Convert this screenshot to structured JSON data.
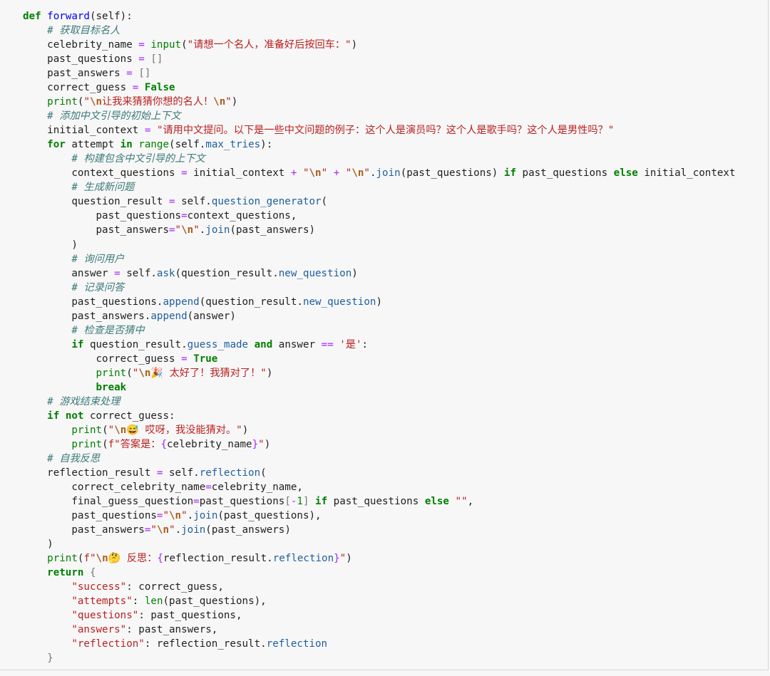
{
  "lines": [
    [
      [
        "k",
        "def"
      ],
      [
        "n",
        " "
      ],
      [
        "f",
        "forward"
      ],
      [
        "p",
        "(self):"
      ]
    ],
    [
      [
        "n",
        "    "
      ],
      [
        "c",
        "# 获取目标名人"
      ]
    ],
    [
      [
        "n",
        "    celebrity_name "
      ],
      [
        "o",
        "="
      ],
      [
        "n",
        " "
      ],
      [
        "b",
        "input"
      ],
      [
        "p",
        "("
      ],
      [
        "s",
        "\"请想一个名人，准备好后按回车：\""
      ],
      [
        "p",
        ")"
      ]
    ],
    [
      [
        "n",
        "    past_questions "
      ],
      [
        "o",
        "="
      ],
      [
        "n",
        " "
      ],
      [
        "pb",
        "[]"
      ]
    ],
    [
      [
        "n",
        "    past_answers "
      ],
      [
        "o",
        "="
      ],
      [
        "n",
        " "
      ],
      [
        "pb",
        "[]"
      ]
    ],
    [
      [
        "n",
        "    correct_guess "
      ],
      [
        "o",
        "="
      ],
      [
        "n",
        " "
      ],
      [
        "k",
        "False"
      ]
    ],
    [
      [
        "n",
        "    "
      ],
      [
        "b",
        "print"
      ],
      [
        "p",
        "("
      ],
      [
        "s",
        "\""
      ],
      [
        "e",
        "\\n"
      ],
      [
        "s",
        "让我来猜猜你想的名人！"
      ],
      [
        "e",
        "\\n"
      ],
      [
        "s",
        "\""
      ],
      [
        "p",
        ")"
      ]
    ],
    [
      [
        "n",
        "    "
      ],
      [
        "c",
        "# 添加中文引导的初始上下文"
      ]
    ],
    [
      [
        "n",
        "    initial_context "
      ],
      [
        "o",
        "="
      ],
      [
        "n",
        " "
      ],
      [
        "s",
        "\"请用中文提问。以下是一些中文问题的例子：这个人是演员吗？这个人是歌手吗？这个人是男性吗？\""
      ]
    ],
    [
      [
        "n",
        "    "
      ],
      [
        "k",
        "for"
      ],
      [
        "n",
        " attempt "
      ],
      [
        "k",
        "in"
      ],
      [
        "n",
        " "
      ],
      [
        "b",
        "range"
      ],
      [
        "p",
        "(self."
      ],
      [
        "a",
        "max_tries"
      ],
      [
        "p",
        "):"
      ]
    ],
    [
      [
        "n",
        "        "
      ],
      [
        "c",
        "# 构建包含中文引导的上下文"
      ]
    ],
    [
      [
        "n",
        "        context_questions "
      ],
      [
        "o",
        "="
      ],
      [
        "n",
        " initial_context "
      ],
      [
        "o",
        "+"
      ],
      [
        "n",
        " "
      ],
      [
        "s",
        "\""
      ],
      [
        "e",
        "\\n"
      ],
      [
        "s",
        "\""
      ],
      [
        "n",
        " "
      ],
      [
        "o",
        "+"
      ],
      [
        "n",
        " "
      ],
      [
        "s",
        "\""
      ],
      [
        "e",
        "\\n"
      ],
      [
        "s",
        "\""
      ],
      [
        "p",
        "."
      ],
      [
        "a",
        "join"
      ],
      [
        "p",
        "(past_questions) "
      ],
      [
        "k",
        "if"
      ],
      [
        "n",
        " past_questions "
      ],
      [
        "k",
        "else"
      ],
      [
        "n",
        " initial_context"
      ]
    ],
    [
      [
        "n",
        "        "
      ],
      [
        "c",
        "# 生成新问题"
      ]
    ],
    [
      [
        "n",
        "        question_result "
      ],
      [
        "o",
        "="
      ],
      [
        "n",
        " self."
      ],
      [
        "a",
        "question_generator"
      ],
      [
        "p",
        "("
      ]
    ],
    [
      [
        "n",
        "            past_questions"
      ],
      [
        "o",
        "="
      ],
      [
        "n",
        "context_questions,"
      ]
    ],
    [
      [
        "n",
        "            past_answers"
      ],
      [
        "o",
        "="
      ],
      [
        "s",
        "\""
      ],
      [
        "e",
        "\\n"
      ],
      [
        "s",
        "\""
      ],
      [
        "p",
        "."
      ],
      [
        "a",
        "join"
      ],
      [
        "p",
        "(past_answers)"
      ]
    ],
    [
      [
        "n",
        "        )"
      ]
    ],
    [
      [
        "n",
        "        "
      ],
      [
        "c",
        "# 询问用户"
      ]
    ],
    [
      [
        "n",
        "        answer "
      ],
      [
        "o",
        "="
      ],
      [
        "n",
        " self."
      ],
      [
        "a",
        "ask"
      ],
      [
        "p",
        "(question_result."
      ],
      [
        "a",
        "new_question"
      ],
      [
        "p",
        ")"
      ]
    ],
    [
      [
        "n",
        "        "
      ],
      [
        "c",
        "# 记录问答"
      ]
    ],
    [
      [
        "n",
        "        past_questions."
      ],
      [
        "a",
        "append"
      ],
      [
        "p",
        "(question_result."
      ],
      [
        "a",
        "new_question"
      ],
      [
        "p",
        ")"
      ]
    ],
    [
      [
        "n",
        "        past_answers."
      ],
      [
        "a",
        "append"
      ],
      [
        "p",
        "(answer)"
      ]
    ],
    [
      [
        "n",
        "        "
      ],
      [
        "c",
        "# 检查是否猜中"
      ]
    ],
    [
      [
        "n",
        "        "
      ],
      [
        "k",
        "if"
      ],
      [
        "n",
        " question_result."
      ],
      [
        "a",
        "guess_made"
      ],
      [
        "n",
        " "
      ],
      [
        "k",
        "and"
      ],
      [
        "n",
        " answer "
      ],
      [
        "o",
        "=="
      ],
      [
        "n",
        " "
      ],
      [
        "s",
        "'是'"
      ],
      [
        "p",
        ":"
      ]
    ],
    [
      [
        "n",
        "            correct_guess "
      ],
      [
        "o",
        "="
      ],
      [
        "n",
        " "
      ],
      [
        "k",
        "True"
      ]
    ],
    [
      [
        "n",
        "            "
      ],
      [
        "b",
        "print"
      ],
      [
        "p",
        "("
      ],
      [
        "s",
        "\""
      ],
      [
        "e",
        "\\n"
      ],
      [
        "s",
        "🎉 太好了！我猜对了！\""
      ],
      [
        "p",
        ")"
      ]
    ],
    [
      [
        "n",
        "            "
      ],
      [
        "k",
        "break"
      ]
    ],
    [
      [
        "n",
        "    "
      ],
      [
        "c",
        "# 游戏结束处理"
      ]
    ],
    [
      [
        "n",
        "    "
      ],
      [
        "k",
        "if"
      ],
      [
        "n",
        " "
      ],
      [
        "k",
        "not"
      ],
      [
        "n",
        " correct_guess:"
      ]
    ],
    [
      [
        "n",
        "        "
      ],
      [
        "b",
        "print"
      ],
      [
        "p",
        "("
      ],
      [
        "s",
        "\""
      ],
      [
        "e",
        "\\n"
      ],
      [
        "s",
        "😅 哎呀，我没能猜对。\""
      ],
      [
        "p",
        ")"
      ]
    ],
    [
      [
        "n",
        "        "
      ],
      [
        "b",
        "print"
      ],
      [
        "p",
        "("
      ],
      [
        "s",
        "f\"答案是："
      ],
      [
        "o",
        "{"
      ],
      [
        "n",
        "celebrity_name"
      ],
      [
        "o",
        "}"
      ],
      [
        "s",
        "\""
      ],
      [
        "p",
        ")"
      ]
    ],
    [
      [
        "n",
        "    "
      ],
      [
        "c",
        "# 自我反思"
      ]
    ],
    [
      [
        "n",
        "    reflection_result "
      ],
      [
        "o",
        "="
      ],
      [
        "n",
        " self."
      ],
      [
        "a",
        "reflection"
      ],
      [
        "p",
        "("
      ]
    ],
    [
      [
        "n",
        "        correct_celebrity_name"
      ],
      [
        "o",
        "="
      ],
      [
        "n",
        "celebrity_name,"
      ]
    ],
    [
      [
        "n",
        "        final_guess_question"
      ],
      [
        "o",
        "="
      ],
      [
        "n",
        "past_questions"
      ],
      [
        "pb",
        "["
      ],
      [
        "o",
        "-"
      ],
      [
        "nu",
        "1"
      ],
      [
        "pb",
        "]"
      ],
      [
        "n",
        " "
      ],
      [
        "k",
        "if"
      ],
      [
        "n",
        " past_questions "
      ],
      [
        "k",
        "else"
      ],
      [
        "n",
        " "
      ],
      [
        "s",
        "\"\""
      ],
      [
        "p",
        ","
      ]
    ],
    [
      [
        "n",
        "        past_questions"
      ],
      [
        "o",
        "="
      ],
      [
        "s",
        "\""
      ],
      [
        "e",
        "\\n"
      ],
      [
        "s",
        "\""
      ],
      [
        "p",
        "."
      ],
      [
        "a",
        "join"
      ],
      [
        "p",
        "(past_questions),"
      ]
    ],
    [
      [
        "n",
        "        past_answers"
      ],
      [
        "o",
        "="
      ],
      [
        "s",
        "\""
      ],
      [
        "e",
        "\\n"
      ],
      [
        "s",
        "\""
      ],
      [
        "p",
        "."
      ],
      [
        "a",
        "join"
      ],
      [
        "p",
        "(past_answers)"
      ]
    ],
    [
      [
        "n",
        "    )"
      ]
    ],
    [
      [
        "n",
        "    "
      ],
      [
        "b",
        "print"
      ],
      [
        "p",
        "("
      ],
      [
        "s",
        "f\""
      ],
      [
        "e",
        "\\n"
      ],
      [
        "s",
        "🤔 反思："
      ],
      [
        "o",
        "{"
      ],
      [
        "n",
        "reflection_result."
      ],
      [
        "a",
        "reflection"
      ],
      [
        "o",
        "}"
      ],
      [
        "s",
        "\""
      ],
      [
        "p",
        ")"
      ]
    ],
    [
      [
        "n",
        "    "
      ],
      [
        "k",
        "return"
      ],
      [
        "n",
        " "
      ],
      [
        "pb",
        "{"
      ]
    ],
    [
      [
        "n",
        "        "
      ],
      [
        "s",
        "\"success\""
      ],
      [
        "p",
        ": correct_guess,"
      ]
    ],
    [
      [
        "n",
        "        "
      ],
      [
        "s",
        "\"attempts\""
      ],
      [
        "p",
        ": "
      ],
      [
        "b",
        "len"
      ],
      [
        "p",
        "(past_questions),"
      ]
    ],
    [
      [
        "n",
        "        "
      ],
      [
        "s",
        "\"questions\""
      ],
      [
        "p",
        ": past_questions,"
      ]
    ],
    [
      [
        "n",
        "        "
      ],
      [
        "s",
        "\"answers\""
      ],
      [
        "p",
        ": past_answers,"
      ]
    ],
    [
      [
        "n",
        "        "
      ],
      [
        "s",
        "\"reflection\""
      ],
      [
        "p",
        ": reflection_result."
      ],
      [
        "a",
        "reflection"
      ]
    ],
    [
      [
        "n",
        "    "
      ],
      [
        "pb",
        "}"
      ]
    ]
  ]
}
